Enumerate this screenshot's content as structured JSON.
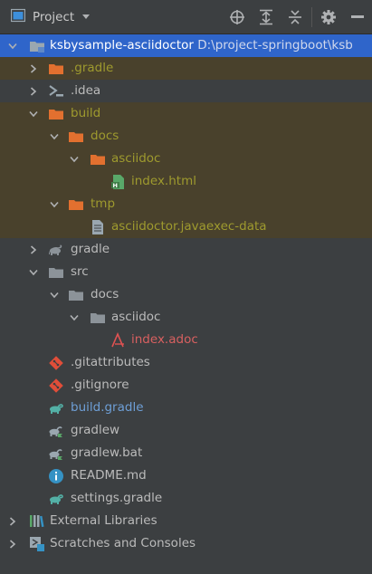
{
  "panel": {
    "title": "Project",
    "icons": [
      "panel-icon",
      "dropdown-chevron-icon",
      "locate-icon",
      "expand-all-icon",
      "collapse-all-icon",
      "gear-icon",
      "hide-icon"
    ]
  },
  "tree": [
    {
      "name": "root-module",
      "label": "ksbysample-asciidoctor",
      "path": "  D:\\project-springboot\\ksb",
      "level": 0,
      "arrow": "down",
      "icon": "module-folder-icon",
      "color": "white",
      "selected": true
    },
    {
      "name": "folder-gradle-hidden",
      "label": ".gradle",
      "level": 1,
      "arrow": "right",
      "icon": "folder-orange-icon",
      "color": "olive",
      "excluded": true
    },
    {
      "name": "folder-idea",
      "label": ".idea",
      "level": 1,
      "arrow": "right",
      "icon": "idea-icon",
      "color": "default"
    },
    {
      "name": "folder-build",
      "label": "build",
      "level": 1,
      "arrow": "down",
      "icon": "folder-orange-icon",
      "color": "olive",
      "excluded": true
    },
    {
      "name": "folder-docs-build",
      "label": "docs",
      "level": 2,
      "arrow": "down",
      "icon": "folder-orange-icon",
      "color": "olive",
      "excluded": true
    },
    {
      "name": "folder-asciidoc-build",
      "label": "asciidoc",
      "level": 3,
      "arrow": "down",
      "icon": "folder-orange-icon",
      "color": "olive",
      "excluded": true
    },
    {
      "name": "file-index-html",
      "label": "index.html",
      "level": 4,
      "icon": "html-file-icon",
      "color": "olive",
      "excluded": true
    },
    {
      "name": "folder-tmp",
      "label": "tmp",
      "level": 2,
      "arrow": "down",
      "icon": "folder-orange-icon",
      "color": "olive",
      "excluded": true
    },
    {
      "name": "file-javaexec-data",
      "label": "asciidoctor.javaexec-data",
      "level": 3,
      "icon": "text-file-icon",
      "color": "olive",
      "excluded": true
    },
    {
      "name": "folder-gradle",
      "label": "gradle",
      "level": 1,
      "arrow": "right",
      "icon": "gradle-folder-icon",
      "color": "default"
    },
    {
      "name": "folder-src",
      "label": "src",
      "level": 1,
      "arrow": "down",
      "icon": "folder-gray-icon",
      "color": "default"
    },
    {
      "name": "folder-docs-src",
      "label": "docs",
      "level": 2,
      "arrow": "down",
      "icon": "folder-gray-icon",
      "color": "default"
    },
    {
      "name": "folder-asciidoc-src",
      "label": "asciidoc",
      "level": 3,
      "arrow": "down",
      "icon": "folder-gray-icon",
      "color": "default"
    },
    {
      "name": "file-index-adoc",
      "label": "index.adoc",
      "level": 4,
      "icon": "asciidoc-file-icon",
      "color": "red"
    },
    {
      "name": "file-gitattributes",
      "label": ".gitattributes",
      "level": 1,
      "icon": "git-file-icon",
      "color": "default"
    },
    {
      "name": "file-gitignore",
      "label": ".gitignore",
      "level": 1,
      "icon": "git-file-icon",
      "color": "default"
    },
    {
      "name": "file-build-gradle",
      "label": "build.gradle",
      "level": 1,
      "icon": "gradle-file-icon",
      "color": "blue"
    },
    {
      "name": "file-gradlew",
      "label": "gradlew",
      "level": 1,
      "icon": "gradlew-file-icon",
      "color": "default"
    },
    {
      "name": "file-gradlew-bat",
      "label": "gradlew.bat",
      "level": 1,
      "icon": "gradlew-file-icon",
      "color": "default"
    },
    {
      "name": "file-readme",
      "label": "README.md",
      "level": 1,
      "icon": "info-file-icon",
      "color": "default"
    },
    {
      "name": "file-settings-gradle",
      "label": "settings.gradle",
      "level": 1,
      "icon": "gradle-file-icon",
      "color": "default"
    },
    {
      "name": "external-libraries",
      "label": "External Libraries",
      "level": 0,
      "arrow": "right",
      "icon": "libraries-icon",
      "color": "default"
    },
    {
      "name": "scratches-and-consoles",
      "label": "Scratches and Consoles",
      "level": 0,
      "arrow": "right",
      "icon": "scratches-icon",
      "color": "default"
    }
  ]
}
